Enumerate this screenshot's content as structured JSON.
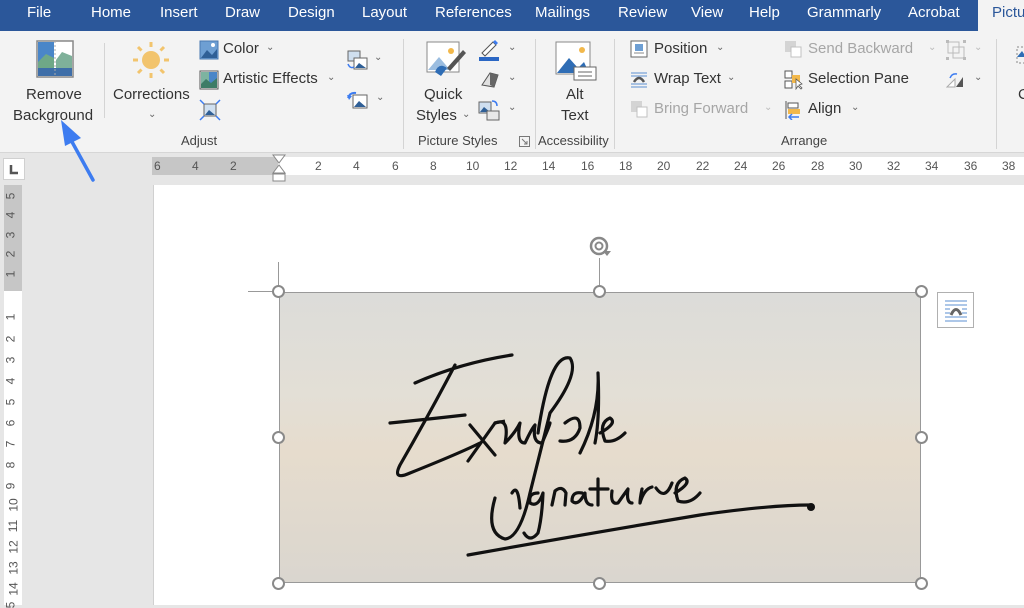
{
  "tabs": [
    {
      "label": "File"
    },
    {
      "label": "Home"
    },
    {
      "label": "Insert"
    },
    {
      "label": "Draw"
    },
    {
      "label": "Design"
    },
    {
      "label": "Layout"
    },
    {
      "label": "References"
    },
    {
      "label": "Mailings"
    },
    {
      "label": "Review"
    },
    {
      "label": "View"
    },
    {
      "label": "Help"
    },
    {
      "label": "Grammarly"
    },
    {
      "label": "Acrobat"
    },
    {
      "label": "Pictu",
      "active": true
    }
  ],
  "ribbon": {
    "remove_background": {
      "line1": "Remove",
      "line2": "Background"
    },
    "adjust": {
      "group_label": "Adjust",
      "corrections": "Corrections",
      "color": "Color",
      "artistic_effects": "Artistic Effects"
    },
    "picture_styles": {
      "group_label": "Picture Styles",
      "quick_line1": "Quick",
      "quick_line2": "Styles"
    },
    "accessibility": {
      "group_label": "Accessibility",
      "alt_line1": "Alt",
      "alt_line2": "Text"
    },
    "arrange": {
      "group_label": "Arrange",
      "position": "Position",
      "wrap_text": "Wrap Text",
      "bring_forward": "Bring Forward",
      "send_backward": "Send Backward",
      "selection_pane": "Selection Pane",
      "align": "Align"
    },
    "cut_off_label": "C"
  },
  "ruler": {
    "horizontal": [
      "6",
      "4",
      "2",
      "2",
      "4",
      "6",
      "8",
      "10",
      "12",
      "14",
      "16",
      "18",
      "20",
      "22",
      "24",
      "26",
      "28",
      "30",
      "32",
      "34",
      "36",
      "38"
    ],
    "vertical": [
      "5",
      "4",
      "3",
      "2",
      "1",
      "1",
      "2",
      "3",
      "4",
      "5",
      "6",
      "7",
      "8",
      "9",
      "10",
      "11",
      "12",
      "13",
      "14",
      "5"
    ]
  },
  "document": {
    "signature_text_line1": "Example",
    "signature_text_line2": "Signature"
  },
  "colors": {
    "tabbar": "#2b579a",
    "ribbon": "#f3f3f3",
    "annotation_arrow": "#3d7cf0"
  }
}
